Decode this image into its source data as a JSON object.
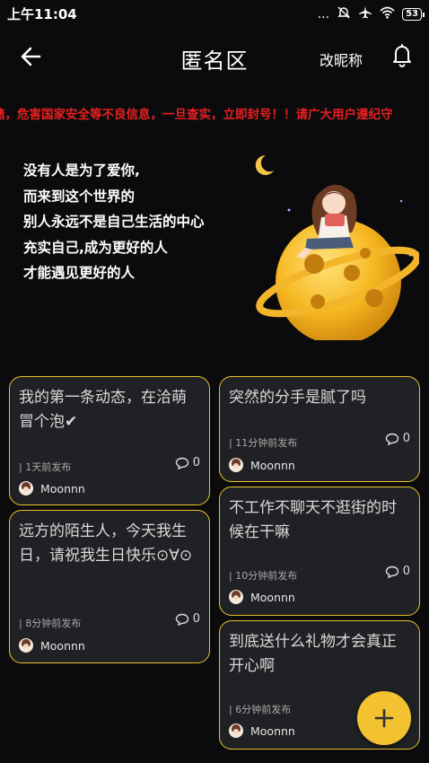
{
  "status_bar": {
    "time": "上午11:04",
    "signal_dots": "...",
    "battery": "53"
  },
  "header": {
    "title": "匿名区",
    "rename_label": "改昵称"
  },
  "notice": {
    "text": "赌，危害国家安全等不良信息，一旦查实，立即封号！！请广大用户遵纪守"
  },
  "hero": {
    "lines": [
      "没有人是为了爱你,",
      "而来到这个世界的",
      "别人永远不是自己生活的中心",
      "充实自己,成为更好的人",
      "才能遇见更好的人"
    ]
  },
  "posts": [
    {
      "content": "我的第一条动态，在洽萌冒个泡✔",
      "time": "| 1天前发布",
      "comments": "0",
      "author": "Moonnn"
    },
    {
      "content": "突然的分手是腻了吗",
      "time": "| 11分钟前发布",
      "comments": "0",
      "author": "Moonnn"
    },
    {
      "content": "远方的陌生人，今天我生日，请祝我生日快乐⊙∀⊙",
      "time": "| 8分钟前发布",
      "comments": "0",
      "author": "Moonnn"
    },
    {
      "content": "不工作不聊天不逛街的时候在干嘛",
      "time": "| 10分钟前发布",
      "comments": "0",
      "author": "Moonnn"
    },
    {
      "content": "到底送什么礼物才会真正开心啊",
      "time": "| 6分钟前发布",
      "author": "Moonnn"
    }
  ],
  "colors": {
    "accent": "#f2c230",
    "card_border": "#e9c22a",
    "notice": "#e82020",
    "background": "#0b0b0d"
  },
  "icons": [
    "back-arrow-icon",
    "bell-icon",
    "comment-icon",
    "plus-icon",
    "moon-icon"
  ]
}
